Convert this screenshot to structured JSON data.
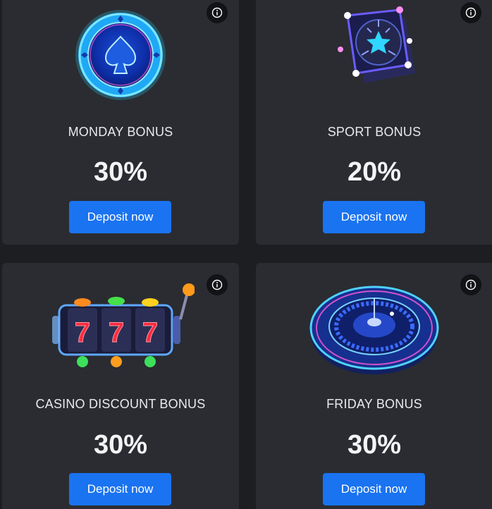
{
  "bonuses": [
    {
      "title": "MONDAY BONUS",
      "percent": "30%",
      "button": "Deposit now",
      "icon": "poker-chip-icon"
    },
    {
      "title": "SPORT BONUS",
      "percent": "20%",
      "button": "Deposit now",
      "icon": "soccer-ball-cube-icon"
    },
    {
      "title": "CASINO DISCOUNT BONUS",
      "percent": "30%",
      "button": "Deposit now",
      "icon": "slot-machine-icon"
    },
    {
      "title": "FRIDAY BONUS",
      "percent": "30%",
      "button": "Deposit now",
      "icon": "roulette-wheel-icon"
    }
  ],
  "colors": {
    "background": "#1c1e22",
    "card": "#2a2c31",
    "button": "#1a73f0",
    "neon_blue": "#2fb8ff",
    "neon_pink": "#ff4fd8"
  }
}
